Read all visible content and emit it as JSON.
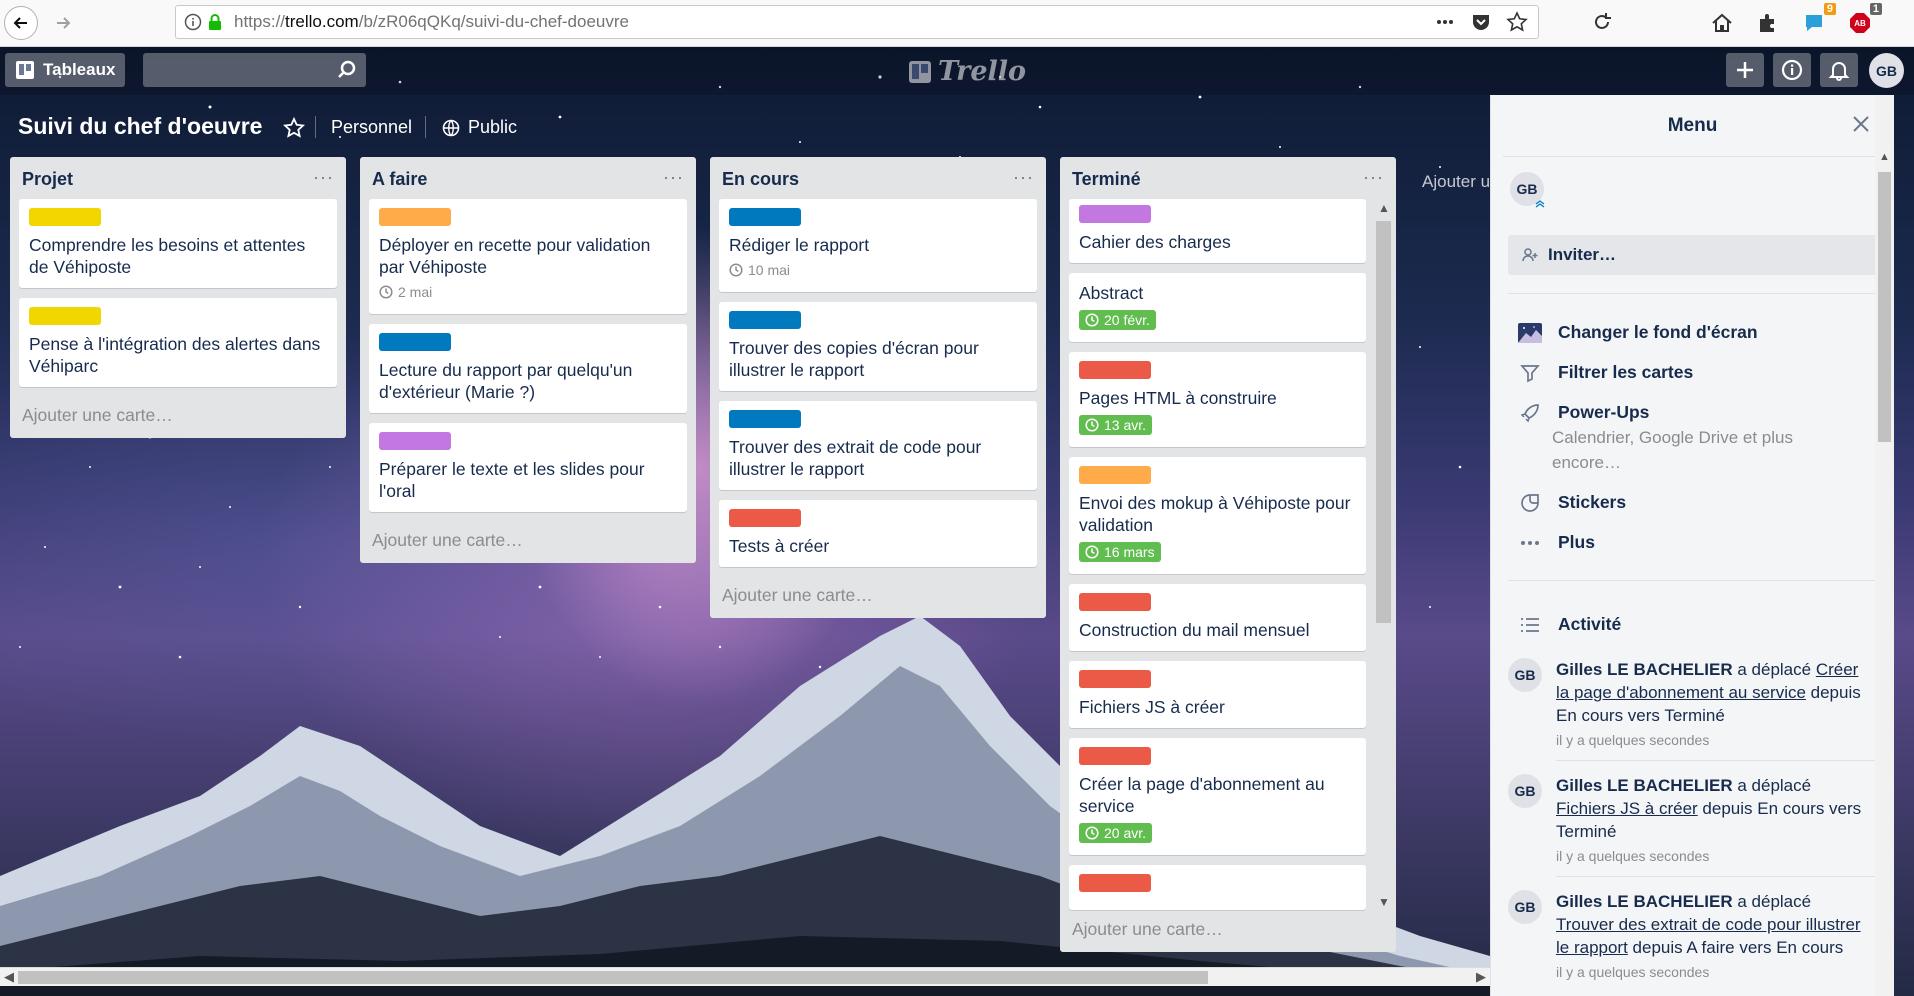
{
  "browser": {
    "url_scheme": "https://",
    "url_host": "trello.com",
    "url_path": "/b/zR06qQKq/suivi-du-chef-doeuvre",
    "badges": {
      "notify": "9",
      "adblock": "1"
    }
  },
  "header": {
    "boards_label": "Tableaux",
    "search_placeholder": "",
    "logo": "Trello",
    "avatar": "GB"
  },
  "board": {
    "title": "Suivi du chef d'oeuvre",
    "team": "Personnel",
    "visibility": "Public",
    "add_list": "Ajouter u"
  },
  "colors": {
    "yellow": "#f2d600",
    "orange": "#ffab4a",
    "blue": "#0079bf",
    "purple": "#c377e0",
    "red": "#eb5a46",
    "green": "#61bd4f"
  },
  "lists": [
    {
      "title": "Projet",
      "cards": [
        {
          "label": "yellow",
          "title": "Comprendre les besoins et attentes de Véhiposte"
        },
        {
          "label": "yellow",
          "title": "Pense à l'intégration des alertes dans Véhiparc"
        }
      ],
      "add": "Ajouter une carte…"
    },
    {
      "title": "A faire",
      "cards": [
        {
          "label": "orange",
          "title": "Déployer en recette pour validation par Véhiposte",
          "due": "2 mai"
        },
        {
          "label": "blue",
          "title": "Lecture du rapport par quelqu'un d'extérieur (Marie ?)"
        },
        {
          "label": "purple",
          "title": "Préparer le texte et les slides pour l'oral"
        }
      ],
      "add": "Ajouter une carte…"
    },
    {
      "title": "En cours",
      "cards": [
        {
          "label": "blue",
          "title": "Rédiger le rapport",
          "due": "10 mai"
        },
        {
          "label": "blue",
          "title": "Trouver des copies d'écran pour illustrer le rapport"
        },
        {
          "label": "blue",
          "title": "Trouver des extrait de code pour illustrer le rapport"
        },
        {
          "label": "red",
          "title": "Tests à créer"
        }
      ],
      "add": "Ajouter une carte…"
    },
    {
      "title": "Terminé",
      "cards": [
        {
          "label": "purple",
          "title": "Cahier des charges"
        },
        {
          "title": "Abstract",
          "due": "20 févr.",
          "done": true
        },
        {
          "label": "red",
          "title": "Pages HTML à construire",
          "due": "13 avr.",
          "done": true
        },
        {
          "label": "orange",
          "title": "Envoi des mokup à Véhiposte pour validation",
          "due": "16 mars",
          "done": true
        },
        {
          "label": "red",
          "title": "Construction du mail mensuel"
        },
        {
          "label": "red",
          "title": "Fichiers JS à créer"
        },
        {
          "label": "red",
          "title": "Créer la page d'abonnement au service",
          "due": "20 avr.",
          "done": true
        },
        {
          "label": "red",
          "title": ""
        }
      ],
      "add": "Ajouter une carte…"
    }
  ],
  "menu": {
    "title": "Menu",
    "avatar": "GB",
    "invite": "Inviter…",
    "items": [
      {
        "icon": "background-thumbnail-icon",
        "label": "Changer le fond d'écran"
      },
      {
        "icon": "filter-icon",
        "label": "Filtrer les cartes"
      },
      {
        "icon": "rocket-icon",
        "label": "Power-Ups",
        "sub": "Calendrier, Google Drive et plus encore…"
      },
      {
        "icon": "sticker-icon",
        "label": "Stickers"
      },
      {
        "icon": "more-icon",
        "label": "Plus"
      }
    ],
    "activity_title": "Activité",
    "activity": [
      {
        "avatar": "GB",
        "user": "Gilles LE BACHELIER",
        "verb": " a déplacé ",
        "card": "Créer la page d'abonnement au service",
        "rest": " depuis En cours vers Terminé",
        "time": "il y a quelques secondes"
      },
      {
        "avatar": "GB",
        "user": "Gilles LE BACHELIER",
        "verb": " a déplacé ",
        "card": "Fichiers JS à créer",
        "rest": " depuis En cours vers Terminé",
        "time": "il y a quelques secondes"
      },
      {
        "avatar": "GB",
        "user": "Gilles LE BACHELIER",
        "verb": " a déplacé ",
        "card": "Trouver des extrait de code pour illustrer le rapport",
        "rest": " depuis A faire vers En cours",
        "time": "il y a quelques secondes"
      }
    ]
  }
}
